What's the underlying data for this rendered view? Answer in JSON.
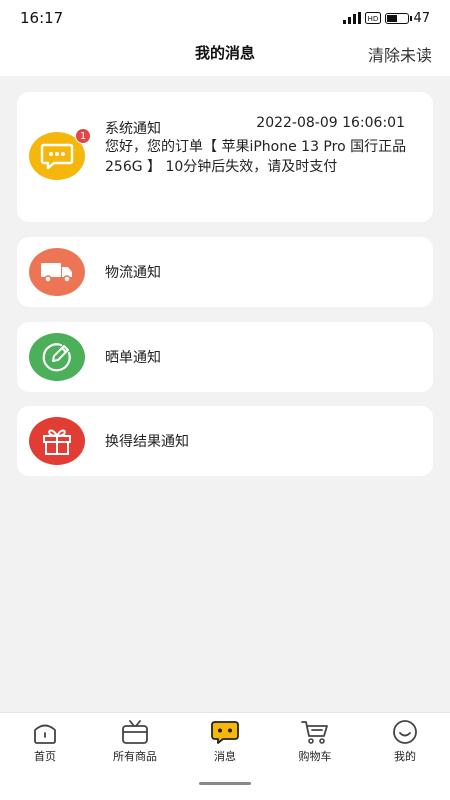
{
  "status_bar": {
    "time": "16:17",
    "signal_text": "4G",
    "hd_text": "HD",
    "battery_level": "47"
  },
  "header": {
    "title": "我的消息",
    "clear_unread": "清除未读"
  },
  "messages": {
    "system": {
      "title": "系统通知",
      "time": "2022-08-09 16:06:01",
      "content": "您好，您的订单【 苹果iPhone 13 Pro 国行正品 256G 】 10分钟后失效，请及时支付",
      "badge_count": "1",
      "icon": "chat-bubble-icon",
      "icon_color": "#f6b70d"
    },
    "logistics": {
      "label": "物流通知",
      "icon": "truck-icon",
      "icon_color": "#ee7456"
    },
    "show_order": {
      "label": "晒单通知",
      "icon": "pencil-circle-icon",
      "icon_color": "#4caf5a"
    },
    "exchange": {
      "label": "换得结果通知",
      "icon": "gift-icon",
      "icon_color": "#e23d34"
    }
  },
  "tabbar": {
    "tabs": [
      {
        "label": "首页",
        "icon": "home-icon"
      },
      {
        "label": "所有商品",
        "icon": "tv-basket-icon"
      },
      {
        "label": "消息",
        "icon": "message-icon",
        "active": true
      },
      {
        "label": "购物车",
        "icon": "cart-icon"
      },
      {
        "label": "我的",
        "icon": "smile-icon"
      }
    ],
    "active_color": "#f6b70d"
  }
}
